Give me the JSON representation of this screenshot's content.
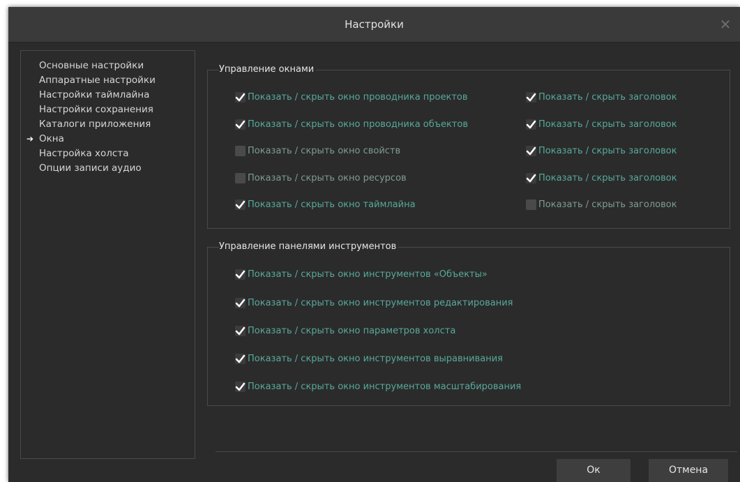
{
  "dialog": {
    "title": "Настройки",
    "close_glyph": "✕"
  },
  "nav": {
    "items": [
      {
        "label": "Основные настройки"
      },
      {
        "label": "Аппаратные настройки"
      },
      {
        "label": "Настройки таймлайна"
      },
      {
        "label": "Настройки сохранения"
      },
      {
        "label": "Каталоги приложения"
      },
      {
        "label": "Окна",
        "selected": true
      },
      {
        "label": "Настройка холста"
      },
      {
        "label": "Опции записи аудио"
      }
    ],
    "selected_marker": "➔"
  },
  "windows_group": {
    "title": "Управление окнами",
    "left": [
      {
        "label": "Показать / скрыть окно проводника проектов",
        "checked": true
      },
      {
        "label": "Показать / скрыть окно проводника объектов",
        "checked": true
      },
      {
        "label": "Показать / скрыть окно свойств",
        "checked": false
      },
      {
        "label": "Показать / скрыть окно ресурсов",
        "checked": false
      },
      {
        "label": "Показать / скрыть окно таймлайна",
        "checked": true
      }
    ],
    "right": [
      {
        "label": "Показать / скрыть заголовок",
        "checked": true
      },
      {
        "label": "Показать / скрыть заголовок",
        "checked": true
      },
      {
        "label": "Показать / скрыть заголовок",
        "checked": true
      },
      {
        "label": "Показать / скрыть заголовок",
        "checked": true
      },
      {
        "label": "Показать / скрыть заголовок",
        "checked": false
      }
    ]
  },
  "toolbars_group": {
    "title": "Управление панелями инструментов",
    "items": [
      {
        "label": "Показать / скрыть окно инструментов «Объекты»",
        "checked": true
      },
      {
        "label": "Показать / скрыть окно инструментов редактирования",
        "checked": true
      },
      {
        "label": "Показать / скрыть окно параметров холста",
        "checked": true
      },
      {
        "label": "Показать / скрыть окно инструментов выравнивания",
        "checked": true
      },
      {
        "label": "Показать / скрыть окно инструментов масштабирования",
        "checked": true
      }
    ]
  },
  "buttons": {
    "ok": "Ок",
    "cancel": "Отмена"
  },
  "colors": {
    "background": "#2b2b2b",
    "titlebar": "#3a3a3a",
    "label_checked": "#58a99b",
    "label_unchecked": "#7f9b96",
    "border": "#4a4a4a"
  }
}
